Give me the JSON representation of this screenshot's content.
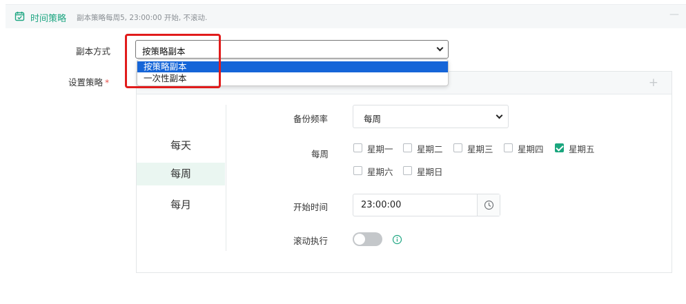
{
  "header": {
    "title": "时间策略",
    "description": "副本策略每周5, 23:00:00 开始, 不滚动.",
    "collapse_label": "—"
  },
  "copy_mode": {
    "label": "副本方式",
    "selected": "按策略副本",
    "options": [
      "按策略副本",
      "一次性副本"
    ]
  },
  "policy": {
    "label": "设置策略",
    "required_mark": "*",
    "add_label": "+"
  },
  "frequency_tabs": [
    {
      "label": "每天",
      "active": false
    },
    {
      "label": "每周",
      "active": true
    },
    {
      "label": "每月",
      "active": false
    }
  ],
  "backup_frequency": {
    "label": "备份频率",
    "value": "每周"
  },
  "weekdays": {
    "label": "每周",
    "days": [
      {
        "label": "星期一",
        "checked": false
      },
      {
        "label": "星期二",
        "checked": false
      },
      {
        "label": "星期三",
        "checked": false
      },
      {
        "label": "星期四",
        "checked": false
      },
      {
        "label": "星期五",
        "checked": true
      },
      {
        "label": "星期六",
        "checked": false
      },
      {
        "label": "星期日",
        "checked": false
      }
    ]
  },
  "start_time": {
    "label": "开始时间",
    "value": "23:00:00"
  },
  "rolling": {
    "label": "滚动执行",
    "enabled": false
  },
  "colors": {
    "accent": "#1ea682",
    "checkbox_on": "#1aa67e",
    "selected_option": "#1565d8",
    "highlight": "#e11b1b"
  },
  "icons": {
    "header": "calendar-check-icon",
    "time": "clock-icon",
    "rolling_info": "info-icon"
  }
}
